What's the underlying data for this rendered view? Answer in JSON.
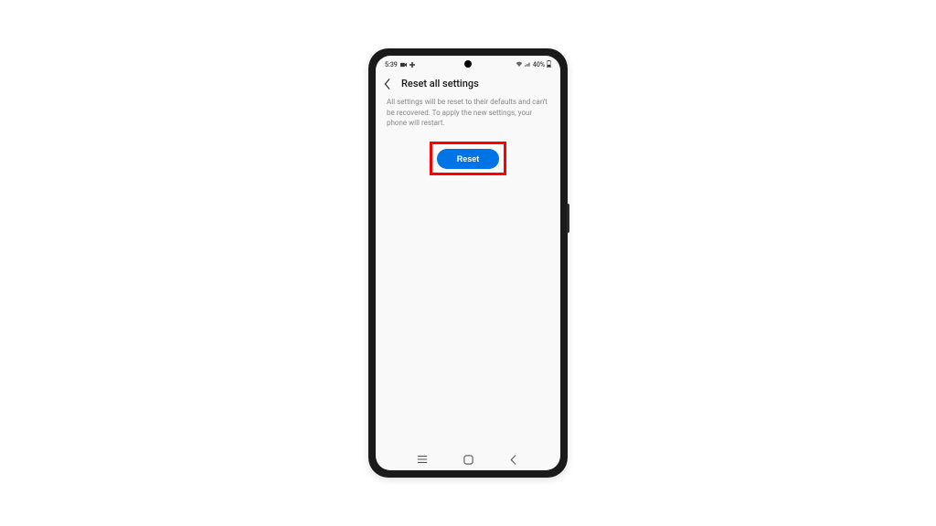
{
  "status_bar": {
    "time": "5:39",
    "battery_text": "40%"
  },
  "header": {
    "title": "Reset all settings"
  },
  "body": {
    "description": "All settings will be reset to their defaults and can't be recovered. To apply the new settings, your phone will restart.",
    "reset_label": "Reset"
  },
  "colors": {
    "accent": "#0073e6",
    "highlight": "#ff0000"
  }
}
